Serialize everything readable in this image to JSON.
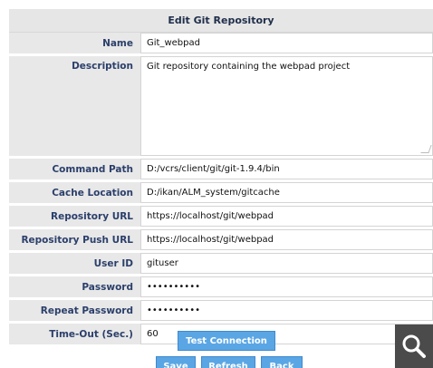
{
  "panel": {
    "title": "Edit Git Repository"
  },
  "form": {
    "name": {
      "label": "Name",
      "value": "Git_webpad"
    },
    "description": {
      "label": "Description",
      "value": "Git repository containing the webpad project"
    },
    "command_path": {
      "label": "Command Path",
      "value": "D:/vcrs/client/git/git-1.9.4/bin"
    },
    "cache_location": {
      "label": "Cache Location",
      "value": "D:/ikan/ALM_system/gitcache"
    },
    "repository_url": {
      "label": "Repository URL",
      "value": "https://localhost/git/webpad"
    },
    "repository_push_url": {
      "label": "Repository Push URL",
      "value": "https://localhost/git/webpad"
    },
    "user_id": {
      "label": "User ID",
      "value": "gituser"
    },
    "password": {
      "label": "Password",
      "value": "••••••••••"
    },
    "repeat_password": {
      "label": "Repeat Password",
      "value": "••••••••••"
    },
    "timeout": {
      "label": "Time-Out (Sec.)",
      "value": "60"
    }
  },
  "buttons": {
    "test_connection": "Test Connection",
    "save": "Save",
    "refresh": "Refresh",
    "back": "Back"
  },
  "icons": {
    "magnifier": "search-icon"
  },
  "colors": {
    "button_bg": "#5aa6e4",
    "label_text": "#2b3f6b",
    "row_bg": "#e8e8e8",
    "header_bg": "#e6e6e6",
    "overlay": "#4b4b4b"
  }
}
